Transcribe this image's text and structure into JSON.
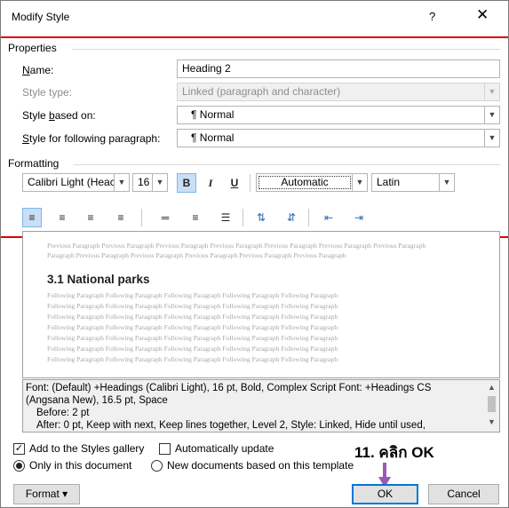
{
  "window": {
    "title": "Modify Style",
    "help": "?",
    "close": "✕"
  },
  "properties": {
    "group_label": "Properties",
    "name_label": "Name:",
    "name_value": "Heading 2",
    "style_type_label": "Style type:",
    "style_type_value": "Linked (paragraph and character)",
    "based_on_label": "Style based on:",
    "based_on_value": "¶  Normal",
    "following_label": "Style for following paragraph:",
    "following_value": "¶  Normal"
  },
  "formatting": {
    "group_label": "Formatting",
    "font": "Calibri Light (Heac",
    "size": "16",
    "bold": "B",
    "italic": "I",
    "underline": "U",
    "color": "Automatic",
    "script": "Latin"
  },
  "preview": {
    "previous_lines": [
      "Previous Paragraph Previous Paragraph Previous Paragraph Previous Paragraph Previous Paragraph Previous Paragraph Previous Paragraph",
      "Paragraph Previous Paragraph Previous Paragraph Previous Paragraph Previous Paragraph Previous Paragraph"
    ],
    "sample_heading": "3.1 National parks",
    "following_lines": [
      "Following Paragraph Following Paragraph Following Paragraph Following Paragraph Following Paragraph",
      "Following Paragraph Following Paragraph Following Paragraph Following Paragraph Following Paragraph",
      "Following Paragraph Following Paragraph Following Paragraph Following Paragraph Following Paragraph",
      "Following Paragraph Following Paragraph Following Paragraph Following Paragraph Following Paragraph",
      "Following Paragraph Following Paragraph Following Paragraph Following Paragraph Following Paragraph",
      "Following Paragraph Following Paragraph Following Paragraph Following Paragraph Following Paragraph",
      "Following Paragraph Following Paragraph Following Paragraph Following Paragraph Following Paragraph"
    ]
  },
  "description": {
    "line1": "Font: (Default) +Headings (Calibri Light), 16 pt, Bold, Complex Script Font: +Headings CS",
    "line2": "(Angsana New), 16.5 pt, Space",
    "line3": "Before:  2 pt",
    "line4": "After:  0 pt, Keep with next, Keep lines together, Level 2, Style: Linked, Hide until used,"
  },
  "options": {
    "add_to_gallery": "Add to the Styles gallery",
    "auto_update": "Automatically update",
    "only_this_doc": "Only in this document",
    "new_docs": "New documents based on this template",
    "add_to_gallery_checked": true,
    "auto_update_checked": false
  },
  "buttons": {
    "format": "Format ▾",
    "ok": "OK",
    "cancel": "Cancel"
  },
  "annotation": {
    "text": "11. คลิก OK",
    "color": "#9b59b6"
  },
  "colors": {
    "accent": "#0078d7",
    "red_line": "#e00000"
  }
}
